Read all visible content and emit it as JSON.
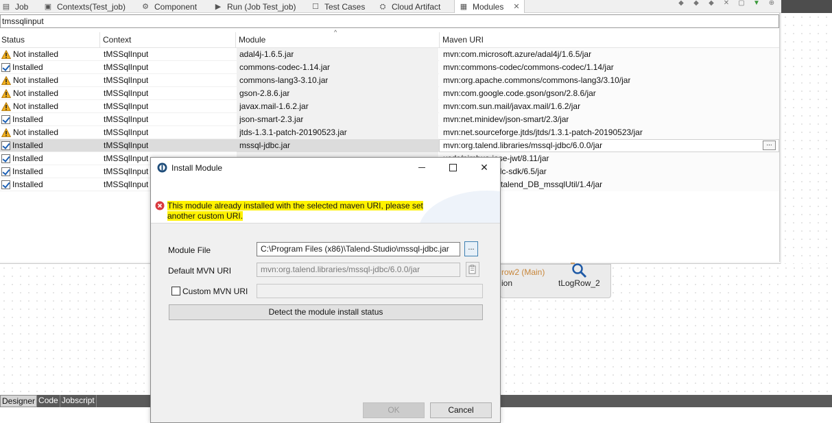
{
  "tabs": [
    {
      "label": "Job",
      "icon": "job-icon"
    },
    {
      "label": "Contexts(Test_job)",
      "icon": "contexts-icon"
    },
    {
      "label": "Component",
      "icon": "component-icon"
    },
    {
      "label": "Run (Job Test_job)",
      "icon": "run-icon"
    },
    {
      "label": "Test Cases",
      "icon": "test-cases-icon"
    },
    {
      "label": "Cloud Artifact",
      "icon": "cloud-artifact-icon"
    },
    {
      "label": "Modules",
      "icon": "modules-icon",
      "active": true
    }
  ],
  "filter": {
    "value": "tmssqlinput"
  },
  "table": {
    "columns": [
      "Status",
      "Context",
      "Module",
      "Maven URI"
    ],
    "rows": [
      {
        "status": "Not installed",
        "status_icon": "warning-icon",
        "context": "tMSSqlInput",
        "module": "adal4j-1.6.5.jar",
        "uri": "mvn:com.microsoft.azure/adal4j/1.6.5/jar"
      },
      {
        "status": "Installed",
        "status_icon": "checkbox-checked-icon",
        "context": "tMSSqlInput",
        "module": "commons-codec-1.14.jar",
        "uri": "mvn:commons-codec/commons-codec/1.14/jar"
      },
      {
        "status": "Not installed",
        "status_icon": "warning-icon",
        "context": "tMSSqlInput",
        "module": "commons-lang3-3.10.jar",
        "uri": "mvn:org.apache.commons/commons-lang3/3.10/jar"
      },
      {
        "status": "Not installed",
        "status_icon": "warning-icon",
        "context": "tMSSqlInput",
        "module": "gson-2.8.6.jar",
        "uri": "mvn:com.google.code.gson/gson/2.8.6/jar"
      },
      {
        "status": "Not installed",
        "status_icon": "warning-icon",
        "context": "tMSSqlInput",
        "module": "javax.mail-1.6.2.jar",
        "uri": "mvn:com.sun.mail/javax.mail/1.6.2/jar"
      },
      {
        "status": "Installed",
        "status_icon": "checkbox-checked-icon",
        "context": "tMSSqlInput",
        "module": "json-smart-2.3.jar",
        "uri": "mvn:net.minidev/json-smart/2.3/jar"
      },
      {
        "status": "Not installed",
        "status_icon": "warning-icon",
        "context": "tMSSqlInput",
        "module": "jtds-1.3.1-patch-20190523.jar",
        "uri": "mvn:net.sourceforge.jtds/jtds/1.3.1-patch-20190523/jar"
      },
      {
        "status": "Installed",
        "status_icon": "checkbox-checked-icon",
        "context": "tMSSqlInput",
        "module": "mssql-jdbc.jar",
        "uri": "mvn:org.talend.libraries/mssql-jdbc/6.0.0/jar",
        "selected": true
      },
      {
        "status": "Installed",
        "status_icon": "checkbox-checked-icon",
        "context": "tMSSqlInput",
        "module": "",
        "uri": "usds/nimbus-jose-jwt/8.11/jar"
      },
      {
        "status": "Installed",
        "status_icon": "checkbox-checked-icon",
        "context": "tMSSqlInput",
        "module": "",
        "uri": "usds/oauth2-oidc-sdk/6.5/jar"
      },
      {
        "status": "Installed",
        "status_icon": "checkbox-checked-icon",
        "context": "tMSSqlInput",
        "module": "",
        "uri": "components.lib/talend_DB_mssqlUtil/1.4/jar"
      }
    ],
    "row_button": "..."
  },
  "canvas": {
    "row_label": "row2 (Main)",
    "partial_label": "ion",
    "component_name": "tLogRow_2"
  },
  "bottom_tabs": [
    "Designer",
    "Code",
    "Jobscript"
  ],
  "dialog": {
    "title": "Install Module",
    "error_message": "This module already installed with the selected maven URI, please set another custom URI.",
    "module_file_label": "Module File",
    "module_file_value": "C:\\Program Files (x86)\\Talend-Studio\\mssql-jdbc.jar",
    "browse_label": "...",
    "default_mvn_label": "Default MVN URI",
    "default_mvn_value": "mvn:org.talend.libraries/mssql-jdbc/6.0.0/jar",
    "custom_mvn_label": "Custom MVN URI",
    "custom_mvn_value": "",
    "detect_button": "Detect the module install status",
    "ok_button": "OK",
    "cancel_button": "Cancel"
  },
  "colors": {
    "highlight": "#fff200",
    "warning": "#f2b01e",
    "error": "#d9393e",
    "tab_bar_dark": "#4d4d4d",
    "row_label": "#c8863a"
  }
}
